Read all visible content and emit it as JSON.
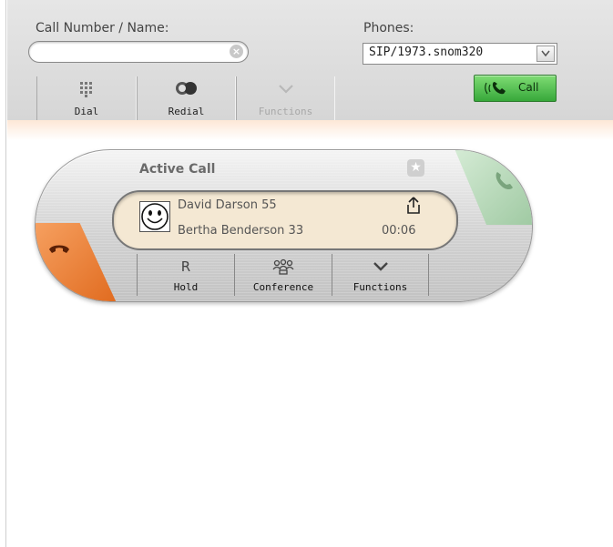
{
  "toolbar": {
    "call_number_label": "Call Number / Name:",
    "phones_label": "Phones:",
    "search": {
      "value": "",
      "placeholder": ""
    },
    "phone_selected": "SIP/1973.snom320",
    "dial_label": "Dial",
    "redial_label": "Redial",
    "functions_label": "Functions",
    "call_label": "Call",
    "call_button_color": "#37a83a"
  },
  "active_call": {
    "title": "Active Call",
    "caller": "David Darson 55",
    "callee": "Bertha Benderson 33",
    "duration": "00:06",
    "hold_label": "Hold",
    "hold_glyph": "R",
    "conference_label": "Conference",
    "functions_label": "Functions",
    "hangup_color": "#e06a1e",
    "answer_color": "#9fc9a2"
  }
}
